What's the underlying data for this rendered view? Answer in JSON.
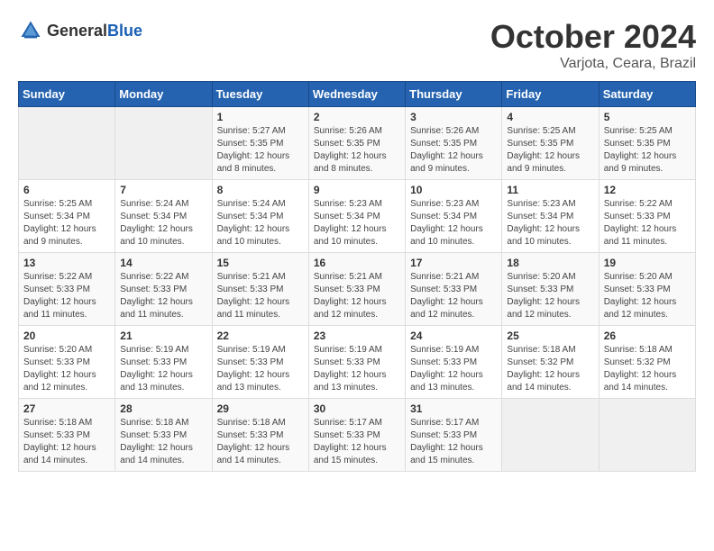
{
  "header": {
    "logo_general": "General",
    "logo_blue": "Blue",
    "month": "October 2024",
    "location": "Varjota, Ceara, Brazil"
  },
  "weekdays": [
    "Sunday",
    "Monday",
    "Tuesday",
    "Wednesday",
    "Thursday",
    "Friday",
    "Saturday"
  ],
  "weeks": [
    [
      {
        "day": "",
        "sunrise": "",
        "sunset": "",
        "daylight": ""
      },
      {
        "day": "",
        "sunrise": "",
        "sunset": "",
        "daylight": ""
      },
      {
        "day": "1",
        "sunrise": "Sunrise: 5:27 AM",
        "sunset": "Sunset: 5:35 PM",
        "daylight": "Daylight: 12 hours and 8 minutes."
      },
      {
        "day": "2",
        "sunrise": "Sunrise: 5:26 AM",
        "sunset": "Sunset: 5:35 PM",
        "daylight": "Daylight: 12 hours and 8 minutes."
      },
      {
        "day": "3",
        "sunrise": "Sunrise: 5:26 AM",
        "sunset": "Sunset: 5:35 PM",
        "daylight": "Daylight: 12 hours and 9 minutes."
      },
      {
        "day": "4",
        "sunrise": "Sunrise: 5:25 AM",
        "sunset": "Sunset: 5:35 PM",
        "daylight": "Daylight: 12 hours and 9 minutes."
      },
      {
        "day": "5",
        "sunrise": "Sunrise: 5:25 AM",
        "sunset": "Sunset: 5:35 PM",
        "daylight": "Daylight: 12 hours and 9 minutes."
      }
    ],
    [
      {
        "day": "6",
        "sunrise": "Sunrise: 5:25 AM",
        "sunset": "Sunset: 5:34 PM",
        "daylight": "Daylight: 12 hours and 9 minutes."
      },
      {
        "day": "7",
        "sunrise": "Sunrise: 5:24 AM",
        "sunset": "Sunset: 5:34 PM",
        "daylight": "Daylight: 12 hours and 10 minutes."
      },
      {
        "day": "8",
        "sunrise": "Sunrise: 5:24 AM",
        "sunset": "Sunset: 5:34 PM",
        "daylight": "Daylight: 12 hours and 10 minutes."
      },
      {
        "day": "9",
        "sunrise": "Sunrise: 5:23 AM",
        "sunset": "Sunset: 5:34 PM",
        "daylight": "Daylight: 12 hours and 10 minutes."
      },
      {
        "day": "10",
        "sunrise": "Sunrise: 5:23 AM",
        "sunset": "Sunset: 5:34 PM",
        "daylight": "Daylight: 12 hours and 10 minutes."
      },
      {
        "day": "11",
        "sunrise": "Sunrise: 5:23 AM",
        "sunset": "Sunset: 5:34 PM",
        "daylight": "Daylight: 12 hours and 10 minutes."
      },
      {
        "day": "12",
        "sunrise": "Sunrise: 5:22 AM",
        "sunset": "Sunset: 5:33 PM",
        "daylight": "Daylight: 12 hours and 11 minutes."
      }
    ],
    [
      {
        "day": "13",
        "sunrise": "Sunrise: 5:22 AM",
        "sunset": "Sunset: 5:33 PM",
        "daylight": "Daylight: 12 hours and 11 minutes."
      },
      {
        "day": "14",
        "sunrise": "Sunrise: 5:22 AM",
        "sunset": "Sunset: 5:33 PM",
        "daylight": "Daylight: 12 hours and 11 minutes."
      },
      {
        "day": "15",
        "sunrise": "Sunrise: 5:21 AM",
        "sunset": "Sunset: 5:33 PM",
        "daylight": "Daylight: 12 hours and 11 minutes."
      },
      {
        "day": "16",
        "sunrise": "Sunrise: 5:21 AM",
        "sunset": "Sunset: 5:33 PM",
        "daylight": "Daylight: 12 hours and 12 minutes."
      },
      {
        "day": "17",
        "sunrise": "Sunrise: 5:21 AM",
        "sunset": "Sunset: 5:33 PM",
        "daylight": "Daylight: 12 hours and 12 minutes."
      },
      {
        "day": "18",
        "sunrise": "Sunrise: 5:20 AM",
        "sunset": "Sunset: 5:33 PM",
        "daylight": "Daylight: 12 hours and 12 minutes."
      },
      {
        "day": "19",
        "sunrise": "Sunrise: 5:20 AM",
        "sunset": "Sunset: 5:33 PM",
        "daylight": "Daylight: 12 hours and 12 minutes."
      }
    ],
    [
      {
        "day": "20",
        "sunrise": "Sunrise: 5:20 AM",
        "sunset": "Sunset: 5:33 PM",
        "daylight": "Daylight: 12 hours and 12 minutes."
      },
      {
        "day": "21",
        "sunrise": "Sunrise: 5:19 AM",
        "sunset": "Sunset: 5:33 PM",
        "daylight": "Daylight: 12 hours and 13 minutes."
      },
      {
        "day": "22",
        "sunrise": "Sunrise: 5:19 AM",
        "sunset": "Sunset: 5:33 PM",
        "daylight": "Daylight: 12 hours and 13 minutes."
      },
      {
        "day": "23",
        "sunrise": "Sunrise: 5:19 AM",
        "sunset": "Sunset: 5:33 PM",
        "daylight": "Daylight: 12 hours and 13 minutes."
      },
      {
        "day": "24",
        "sunrise": "Sunrise: 5:19 AM",
        "sunset": "Sunset: 5:33 PM",
        "daylight": "Daylight: 12 hours and 13 minutes."
      },
      {
        "day": "25",
        "sunrise": "Sunrise: 5:18 AM",
        "sunset": "Sunset: 5:32 PM",
        "daylight": "Daylight: 12 hours and 14 minutes."
      },
      {
        "day": "26",
        "sunrise": "Sunrise: 5:18 AM",
        "sunset": "Sunset: 5:32 PM",
        "daylight": "Daylight: 12 hours and 14 minutes."
      }
    ],
    [
      {
        "day": "27",
        "sunrise": "Sunrise: 5:18 AM",
        "sunset": "Sunset: 5:33 PM",
        "daylight": "Daylight: 12 hours and 14 minutes."
      },
      {
        "day": "28",
        "sunrise": "Sunrise: 5:18 AM",
        "sunset": "Sunset: 5:33 PM",
        "daylight": "Daylight: 12 hours and 14 minutes."
      },
      {
        "day": "29",
        "sunrise": "Sunrise: 5:18 AM",
        "sunset": "Sunset: 5:33 PM",
        "daylight": "Daylight: 12 hours and 14 minutes."
      },
      {
        "day": "30",
        "sunrise": "Sunrise: 5:17 AM",
        "sunset": "Sunset: 5:33 PM",
        "daylight": "Daylight: 12 hours and 15 minutes."
      },
      {
        "day": "31",
        "sunrise": "Sunrise: 5:17 AM",
        "sunset": "Sunset: 5:33 PM",
        "daylight": "Daylight: 12 hours and 15 minutes."
      },
      {
        "day": "",
        "sunrise": "",
        "sunset": "",
        "daylight": ""
      },
      {
        "day": "",
        "sunrise": "",
        "sunset": "",
        "daylight": ""
      }
    ]
  ]
}
